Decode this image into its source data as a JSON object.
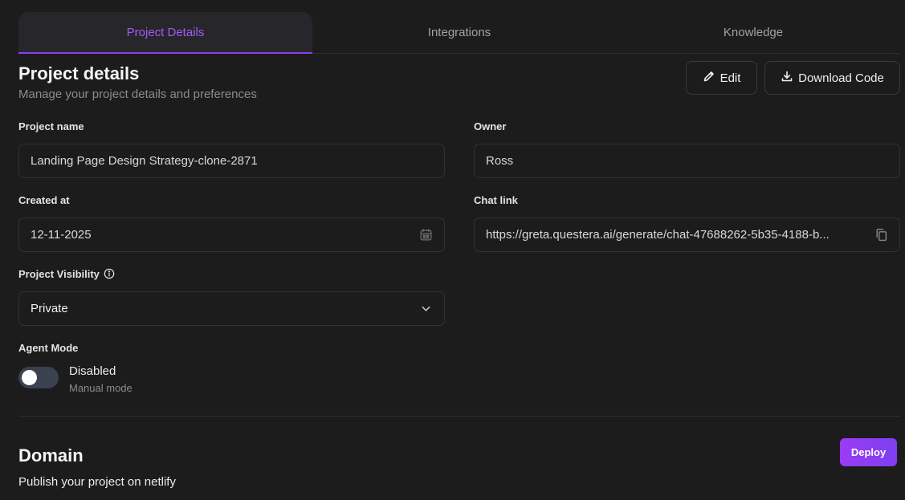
{
  "tabs": [
    {
      "label": "Project Details",
      "active": true
    },
    {
      "label": "Integrations",
      "active": false
    },
    {
      "label": "Knowledge",
      "active": false
    }
  ],
  "header": {
    "title": "Project details",
    "subtitle": "Manage your project details and preferences",
    "edit_label": "Edit",
    "download_label": "Download Code"
  },
  "fields": {
    "project_name": {
      "label": "Project name",
      "value": "Landing Page Design Strategy-clone-2871"
    },
    "owner": {
      "label": "Owner",
      "value": "Ross"
    },
    "created_at": {
      "label": "Created at",
      "value": "12-11-2025"
    },
    "chat_link": {
      "label": "Chat link",
      "value": "https://greta.questera.ai/generate/chat-47688262-5b35-4188-b..."
    },
    "visibility": {
      "label": "Project Visibility",
      "value": "Private"
    }
  },
  "agent_mode": {
    "label": "Agent Mode",
    "state": "Disabled",
    "description": "Manual mode",
    "enabled": false
  },
  "domain": {
    "title": "Domain",
    "subtitle": "Publish your project on netlify",
    "deploy_label": "Deploy"
  },
  "colors": {
    "accent": "#8b3df0",
    "background": "#1c1c1d"
  }
}
